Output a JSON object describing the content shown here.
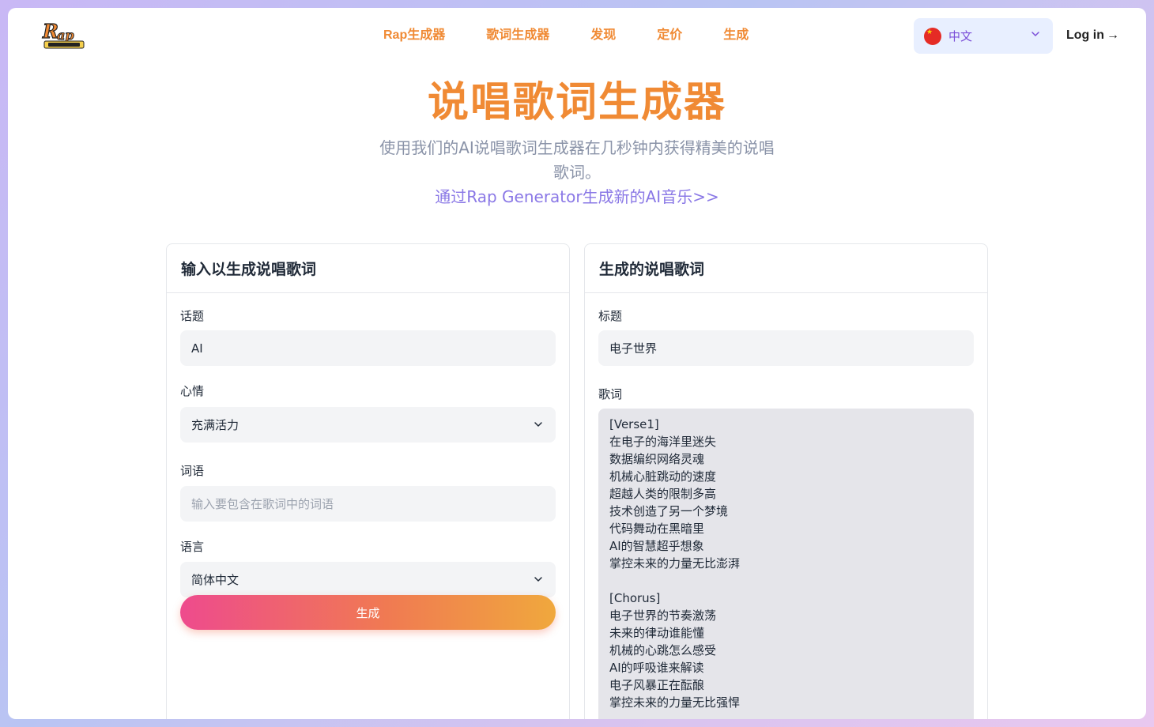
{
  "header": {
    "logo_text": "Rap Generator",
    "nav": [
      {
        "label": "Rap生成器"
      },
      {
        "label": "歌词生成器"
      },
      {
        "label": "发现"
      },
      {
        "label": "定价"
      },
      {
        "label": "生成"
      }
    ],
    "language": {
      "label": "中文",
      "flag": "china-flag-icon"
    },
    "login": {
      "label": "Log in",
      "arrow": "→"
    }
  },
  "hero": {
    "title": "说唱歌词生成器",
    "subtitle": "使用我们的AI说唱歌词生成器在几秒钟内获得精美的说唱歌词。",
    "link": "通过Rap Generator生成新的AI音乐>>"
  },
  "input_card": {
    "title": "输入以生成说唱歌词",
    "topic": {
      "label": "话题",
      "value": "AI"
    },
    "mood": {
      "label": "心情",
      "value": "充满活力"
    },
    "words": {
      "label": "词语",
      "placeholder": "输入要包含在歌词中的词语"
    },
    "language": {
      "label": "语言",
      "value": "简体中文"
    },
    "generate_label": "生成"
  },
  "output_card": {
    "title": "生成的说唱歌词",
    "title_field": {
      "label": "标题",
      "value": "电子世界"
    },
    "lyrics": {
      "label": "歌词",
      "text": "[Verse1]\n在电子的海洋里迷失\n数据编织网络灵魂\n机械心脏跳动的速度\n超越人类的限制多高\n技术创造了另一个梦境\n代码舞动在黑暗里\nAI的智慧超乎想象\n掌控未来的力量无比澎湃\n\n[Chorus]\n电子世界的节奏激荡\n未来的律动谁能懂\n机械的心跳怎么感受\nAI的呼吸谁来解读\n电子风暴正在酝酿\n掌控未来的力量无比强悍"
    }
  },
  "colors": {
    "accent_orange": "#f08a34",
    "link_purple": "#8a78e6",
    "button_gradient_start": "#ee4b8d",
    "button_gradient_end": "#f0a83d"
  }
}
